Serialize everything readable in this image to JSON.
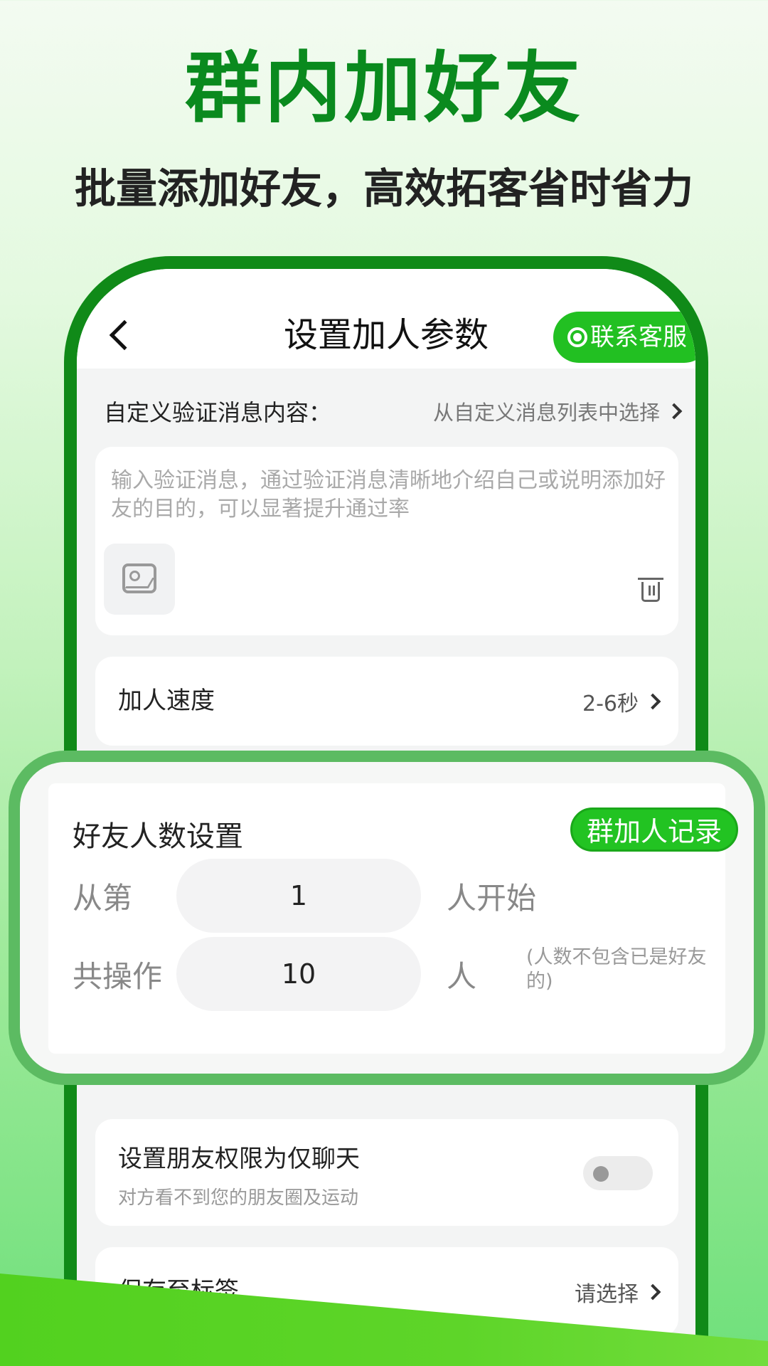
{
  "headline": "群内加好友",
  "subheadline": "批量添加好友，高效拓客省时省力",
  "colors": {
    "brand_green": "#0a8a1e",
    "button_green": "#22c022",
    "phone_frame": "#108a18"
  },
  "screen": {
    "nav": {
      "title": "设置加人参数",
      "back_icon": "chevron-left-icon",
      "contact_button": "联系客服"
    },
    "verify": {
      "label": "自定义验证消息内容：",
      "link": "从自定义消息列表中选择",
      "placeholder": "输入验证消息，通过验证消息清晰地介绍自己或说明添加好友的目的，可以显著提升通过率"
    },
    "speed": {
      "label": "加人速度",
      "value": "2-6秒"
    },
    "friend_count": {
      "title": "好友人数设置",
      "record_button": "群加人记录",
      "start_prefix": "从第",
      "start_value": "1",
      "start_suffix": "人开始",
      "total_prefix": "共操作",
      "total_value": "10",
      "total_suffix": "人",
      "note": "(人数不包含已是好友的)"
    },
    "permission": {
      "title": "设置朋友权限为仅聊天",
      "subtitle": "对方看不到您的朋友圈及运动",
      "enabled": false
    },
    "save_label": {
      "label": "保存至标签",
      "value": "请选择"
    }
  }
}
